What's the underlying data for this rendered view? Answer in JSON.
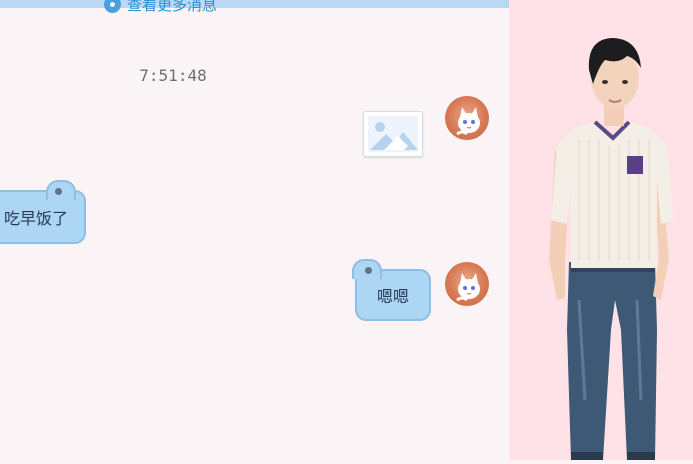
{
  "chat": {
    "more_messages_label": "查看更多消息",
    "timestamp": "7:51:48",
    "messages": [
      {
        "side": "right",
        "type": "image"
      },
      {
        "side": "left",
        "type": "text",
        "text": "吃早饭了"
      },
      {
        "side": "right",
        "type": "text",
        "text": "嗯嗯"
      }
    ]
  },
  "colors": {
    "bubble_fill": "#acd6f3",
    "bubble_border": "#8ebfe2",
    "side_panel": "#ffe2e7",
    "link": "#2a8fd2"
  },
  "icons": [
    "more-messages-icon",
    "avatar-cat-icon",
    "image-placeholder-icon"
  ]
}
